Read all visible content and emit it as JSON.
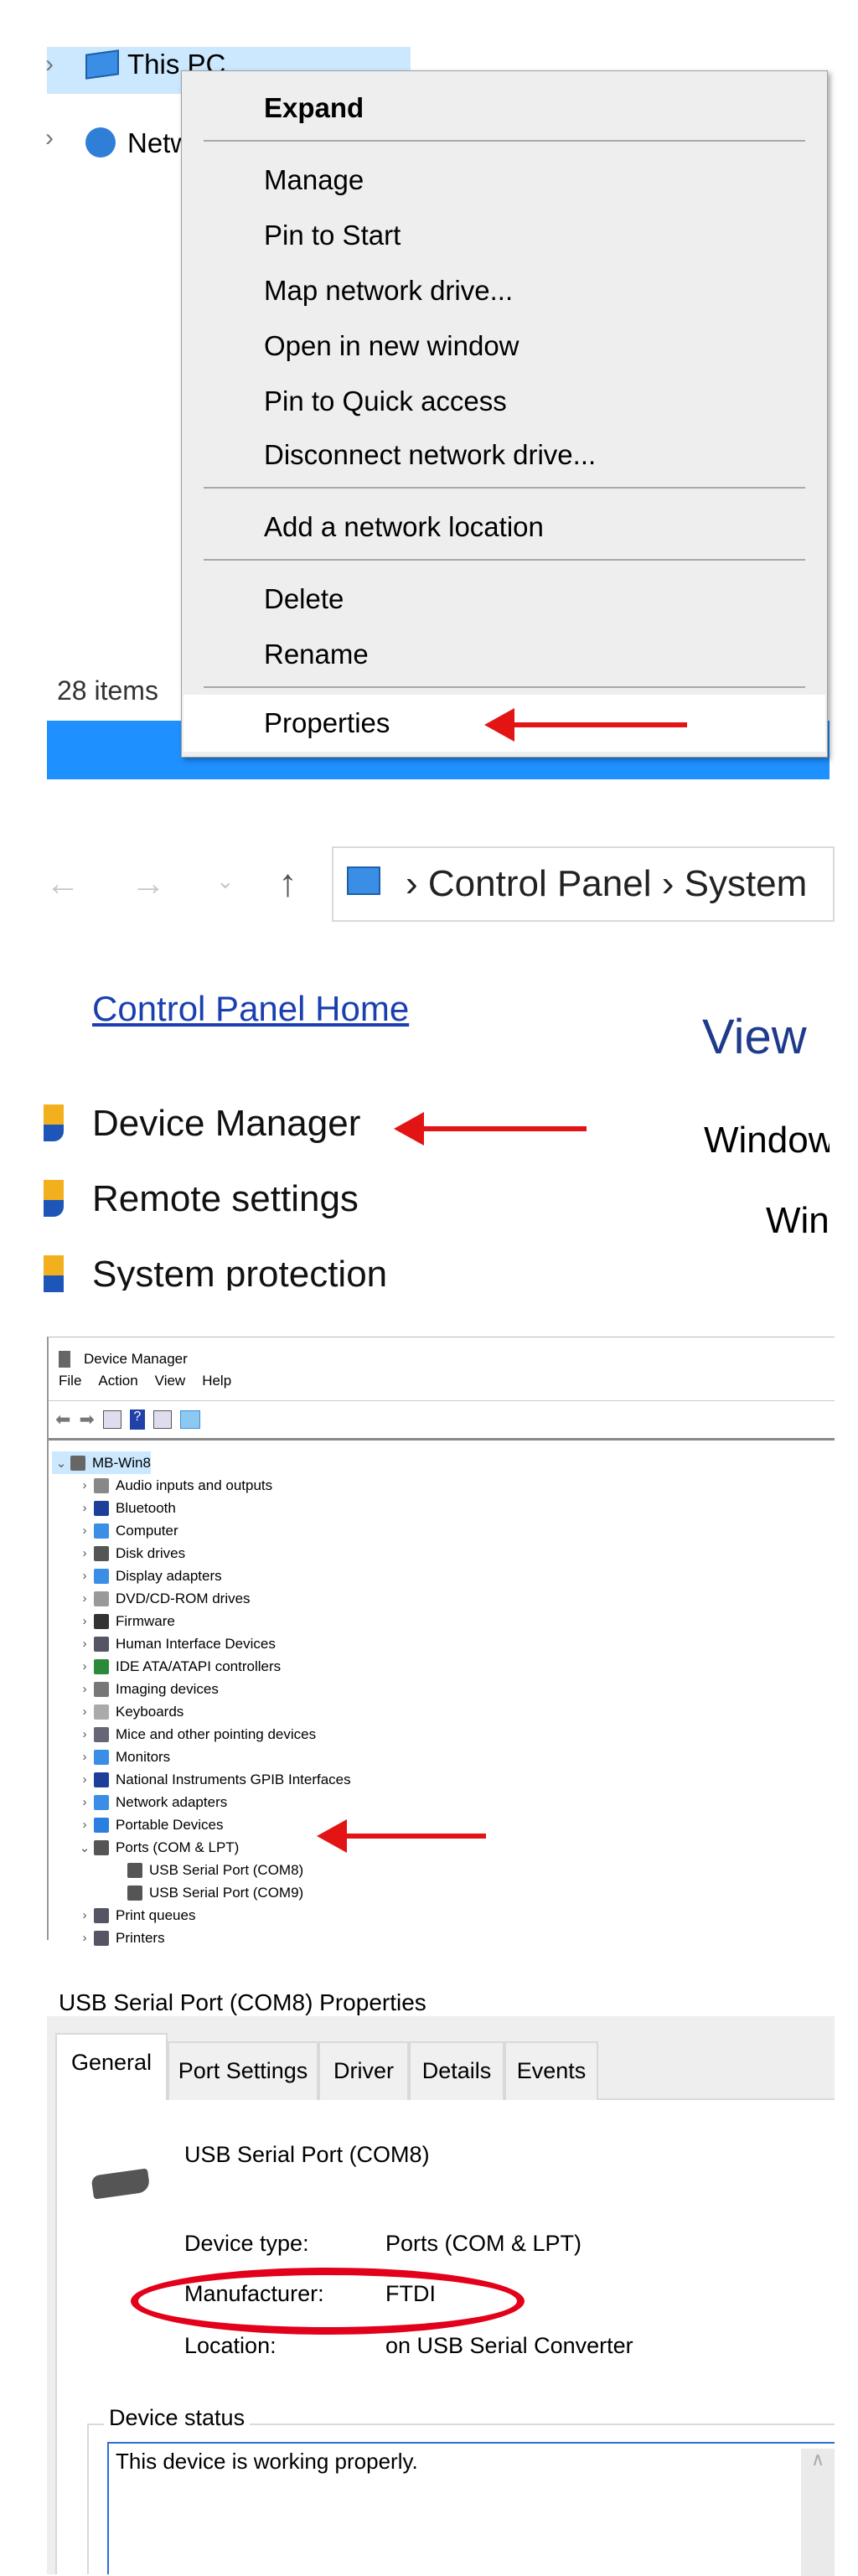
{
  "explorer": {
    "tree": [
      {
        "label": "This PC",
        "icon": "computer-icon",
        "selected": true
      },
      {
        "label": "Network",
        "icon": "network-icon"
      }
    ],
    "status": "28 items",
    "taskbar_color": "#1e90ff"
  },
  "context_menu": {
    "items": [
      "Expand",
      "Manage",
      "Pin to Start",
      "Map network drive...",
      "Open in new window",
      "Pin to Quick access",
      "Disconnect network drive...",
      "Add a network location",
      "Delete",
      "Rename",
      "Properties"
    ],
    "highlighted": "Properties"
  },
  "control_panel": {
    "breadcrumb": [
      "Control Panel",
      "System"
    ],
    "home_link": "Control Panel Home",
    "links": [
      "Device Manager",
      "Remote settings",
      "System protection"
    ],
    "view_heading": "View",
    "right_texts": [
      "Window",
      "Win"
    ]
  },
  "device_manager": {
    "title": "Device Manager",
    "menu": [
      "File",
      "Action",
      "View",
      "Help"
    ],
    "root": "MB-Win8",
    "categories": [
      "Audio inputs and outputs",
      "Bluetooth",
      "Computer",
      "Disk drives",
      "Display adapters",
      "DVD/CD-ROM drives",
      "Firmware",
      "Human Interface Devices",
      "IDE ATA/ATAPI controllers",
      "Imaging devices",
      "Keyboards",
      "Mice and other pointing devices",
      "Monitors",
      "National Instruments GPIB Interfaces",
      "Network adapters",
      "Portable Devices",
      "Ports (COM & LPT)",
      "Print queues",
      "Printers"
    ],
    "ports_children": [
      "USB Serial Port (COM8)",
      "USB Serial Port (COM9)"
    ],
    "expanded": "Ports (COM & LPT)"
  },
  "properties": {
    "title": "USB Serial Port (COM8) Properties",
    "tabs": [
      "General",
      "Port Settings",
      "Driver",
      "Details",
      "Events"
    ],
    "active_tab": "General",
    "device_name": "USB Serial Port (COM8)",
    "fields": [
      {
        "label": "Device type:",
        "value": "Ports (COM & LPT)"
      },
      {
        "label": "Manufacturer:",
        "value": "FTDI"
      },
      {
        "label": "Location:",
        "value": "on USB Serial Converter"
      }
    ],
    "status_group": "Device status",
    "status_text": "This device is working properly.",
    "highlight_color": "#e3001b"
  }
}
